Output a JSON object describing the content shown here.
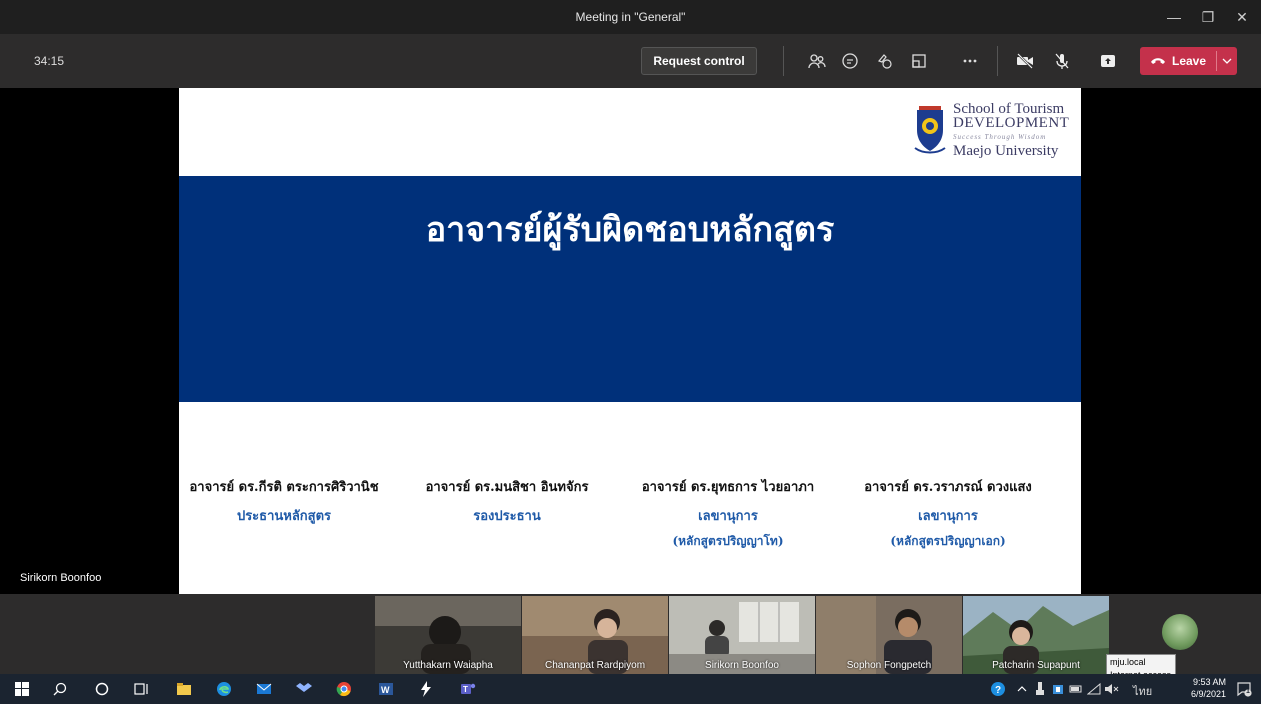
{
  "window": {
    "title": "Meeting in \"General\"",
    "minimize": "—",
    "restore": "❐",
    "close": "✕"
  },
  "toolbar": {
    "timer": "34:15",
    "request_control": "Request control",
    "leave_label": "Leave",
    "icons": [
      "people-icon",
      "chat-icon",
      "reactions-icon",
      "room-icon",
      "more-icon",
      "camera-off-icon",
      "mic-off-icon",
      "share-icon"
    ]
  },
  "slide": {
    "logo": {
      "line1": "School of Tourism",
      "line2": "DEVELOPMENT",
      "line3": "Success Through Wisdom",
      "line4": "Maejo University"
    },
    "heading": "อาจารย์ผู้รับผิดชอบหลักสูตร",
    "people": [
      {
        "name": "อาจารย์ ดร.กีรติ  ตระการศิริวานิช",
        "role": "ประธานหลักสูตร",
        "sub": ""
      },
      {
        "name": "อาจารย์ ดร.มนสิชา  อินทจักร",
        "role": "รองประธาน",
        "sub": ""
      },
      {
        "name": "อาจารย์ ดร.ยุทธการ  ไวยอาภา",
        "role": "เลขานุการ",
        "sub": "(หลักสูตรปริญญาโท)"
      },
      {
        "name": "อาจารย์ ดร.วราภรณ์  ดวงแสง",
        "role": "เลขานุการ",
        "sub": "(หลักสูตรปริญญาเอก)"
      }
    ]
  },
  "presenter_name": "Sirikorn Boonfoo",
  "participants": [
    {
      "name": "Yutthakarn Waiapha",
      "color": "#5a4a3c"
    },
    {
      "name": "Chananpat Rardpiyom",
      "color": "#8a6a4e"
    },
    {
      "name": "Sirikorn Boonfoo",
      "color": "#9a9a94"
    },
    {
      "name": "Sophon Fongpetch",
      "color": "#6b5a4a"
    },
    {
      "name": "Patcharin Supapunt",
      "color": "#7f9bb0"
    }
  ],
  "tooltip": {
    "line1": "mju.local",
    "line2": "Internet access"
  },
  "taskbar": {
    "lang": "ไทย",
    "time": "9:53 AM",
    "date": "6/9/2021",
    "notif_count": "1"
  }
}
